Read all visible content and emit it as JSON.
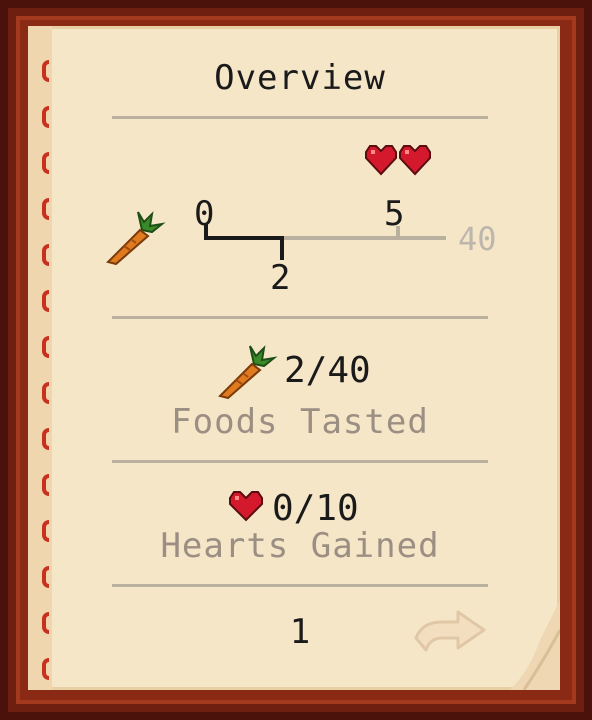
{
  "panel": {
    "title": "Overview"
  },
  "progress": {
    "start_label": "0",
    "current_label": "2",
    "milestone_label": "5",
    "max_label": "40",
    "current_value": 2,
    "milestone_value": 5,
    "max_value": 40,
    "milestone_icon": "double-heart-icon",
    "track_icon": "carrot-icon"
  },
  "foods": {
    "value": "2/40",
    "caption": "Foods Tasted",
    "icon": "carrot-icon"
  },
  "hearts": {
    "value": "0/10",
    "caption": "Hearts Gained",
    "icon": "heart-icon"
  },
  "pagination": {
    "page_number": "1",
    "next_icon": "page-turn-arrow-icon"
  },
  "colors": {
    "frame": "#6e1f10",
    "page": "#f6e6c8",
    "stitch": "#c8311e",
    "heart": "#d4192c",
    "carrot": "#e07a1f",
    "leaf": "#3a8a2a",
    "muted_text": "#9a8f82"
  }
}
